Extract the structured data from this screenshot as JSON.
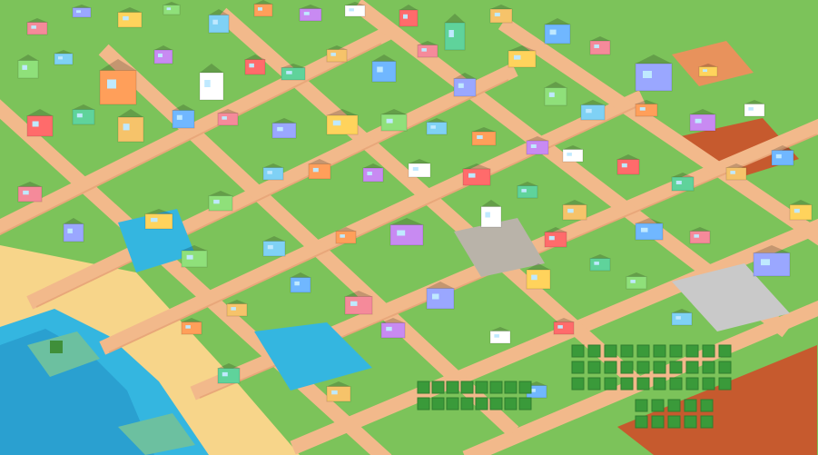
{
  "scene": {
    "type": "isometric-voxel-city-overview",
    "colors": {
      "grass": "#7cc35a",
      "grass_dark": "#5fae46",
      "road": "#f2b98b",
      "road_edge": "#e39c70",
      "sidewalk": "#f7d2ac",
      "plaza": "#c9c9c9",
      "water": "#34b6e0",
      "water_light": "#7fd9f2",
      "sand": "#f7d58a",
      "dirt": "#c65a2e",
      "canal": "#8fb8b8"
    }
  }
}
